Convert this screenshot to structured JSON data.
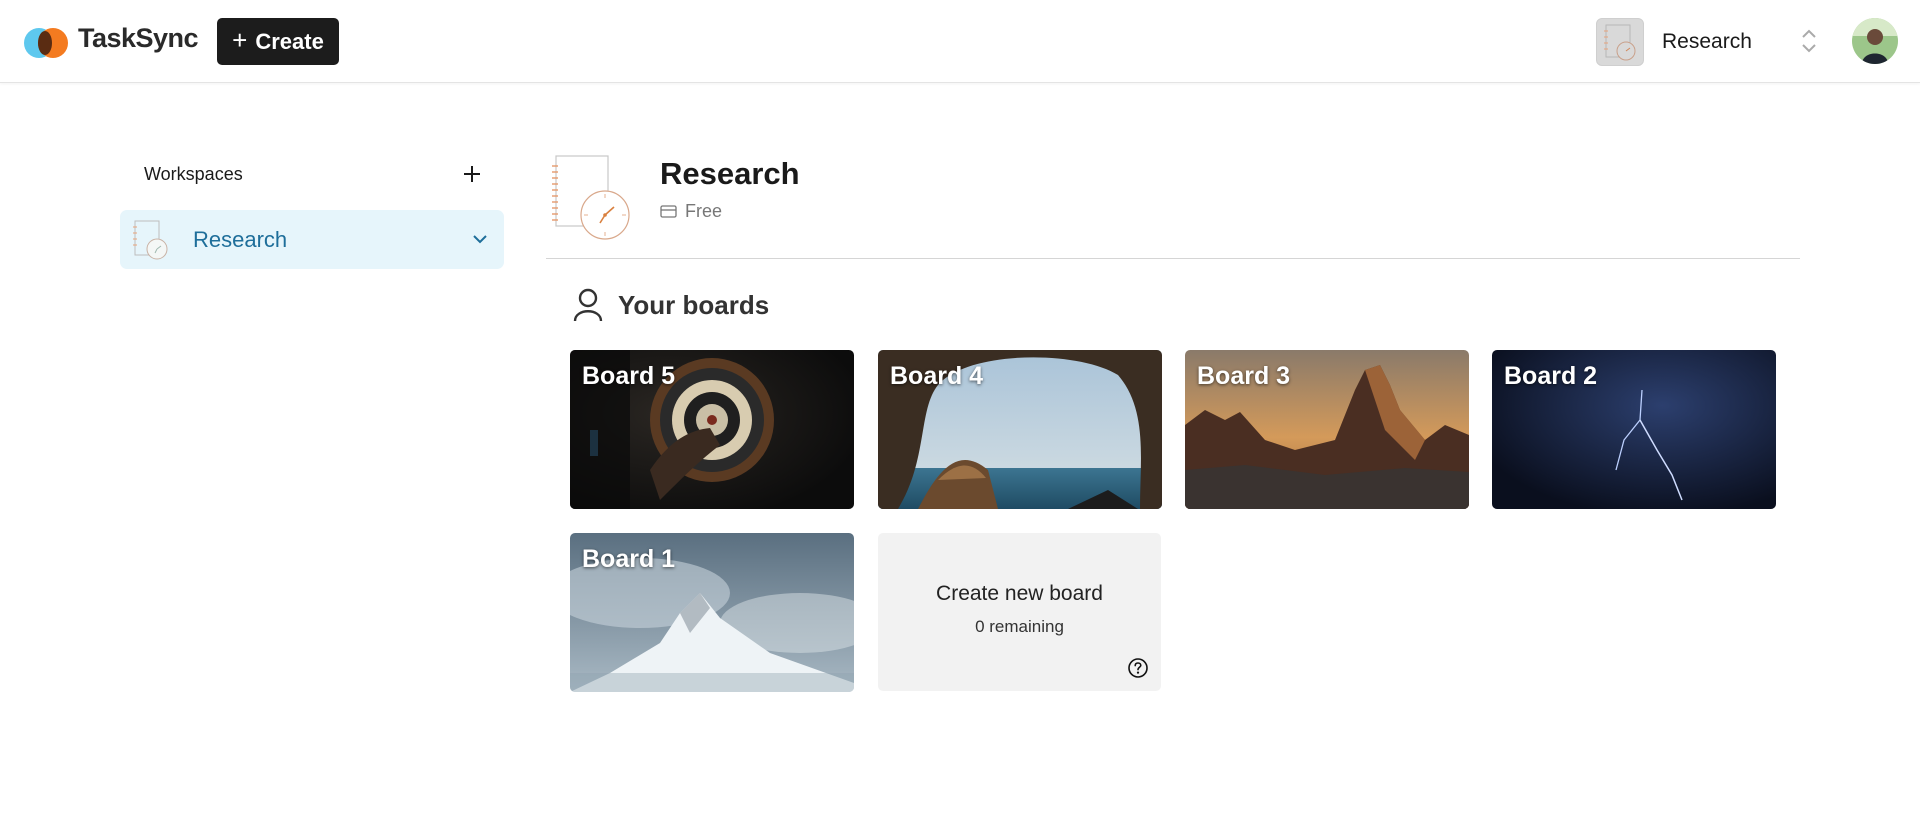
{
  "app": {
    "name": "TaskSync"
  },
  "header": {
    "create_label": "Create",
    "workspace_name": "Research"
  },
  "sidebar": {
    "title": "Workspaces",
    "items": [
      {
        "label": "Research"
      }
    ]
  },
  "workspace": {
    "title": "Research",
    "plan": "Free"
  },
  "boards_section": {
    "title": "Your boards",
    "boards": [
      {
        "label": "Board 5",
        "image": "dartboard-photo"
      },
      {
        "label": "Board 4",
        "image": "sea-cave-photo"
      },
      {
        "label": "Board 3",
        "image": "mountain-sunset-photo"
      },
      {
        "label": "Board 2",
        "image": "lightning-storm-photo"
      },
      {
        "label": "Board 1",
        "image": "snowy-mountain-photo"
      }
    ],
    "new_board": {
      "title": "Create new board",
      "remaining": "0 remaining"
    }
  },
  "colors": {
    "accent_blue": "#1e6e9a",
    "selected_bg": "#e6f5fb",
    "logo_blue": "#5ec8ee",
    "logo_orange": "#f47b20",
    "button_dark": "#1c1c1c"
  }
}
